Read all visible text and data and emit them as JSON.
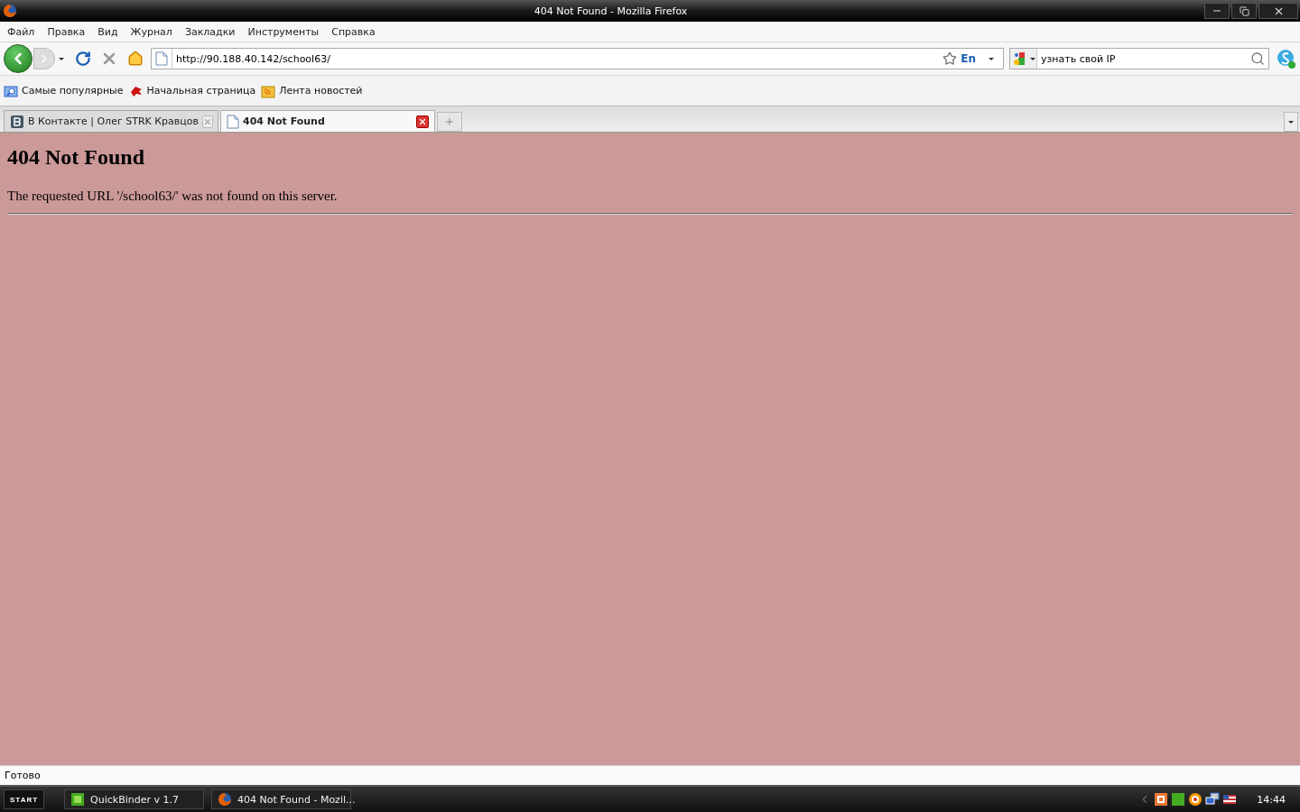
{
  "window": {
    "title": "404 Not Found - Mozilla Firefox"
  },
  "menu": [
    "Файл",
    "Правка",
    "Вид",
    "Журнал",
    "Закладки",
    "Инструменты",
    "Справка"
  ],
  "navigation": {
    "url": "http://90.188.40.142/school63/",
    "language": "En",
    "search_value": "узнать свой IP"
  },
  "bookmarks": [
    {
      "kind": "search",
      "label": "Самые популярные"
    },
    {
      "kind": "bird",
      "label": "Начальная страница"
    },
    {
      "kind": "feed",
      "label": "Лента новостей"
    }
  ],
  "tabs": [
    {
      "kind": "vk",
      "label": "В Контакте | Олег STRK Кравцов",
      "selected": false
    },
    {
      "kind": "page",
      "label": "404 Not Found",
      "selected": true
    }
  ],
  "page": {
    "heading": "404 Not Found",
    "message": "The requested URL '/school63/' was not found on this server."
  },
  "status_bar": {
    "text": "Готово"
  },
  "taskbar": {
    "start": "START",
    "tasks": [
      {
        "kind": "binder",
        "label": "QuickBinder v 1.7"
      },
      {
        "kind": "firefox",
        "label": "404 Not Found - Mozil..."
      }
    ],
    "clock": "14:44"
  }
}
